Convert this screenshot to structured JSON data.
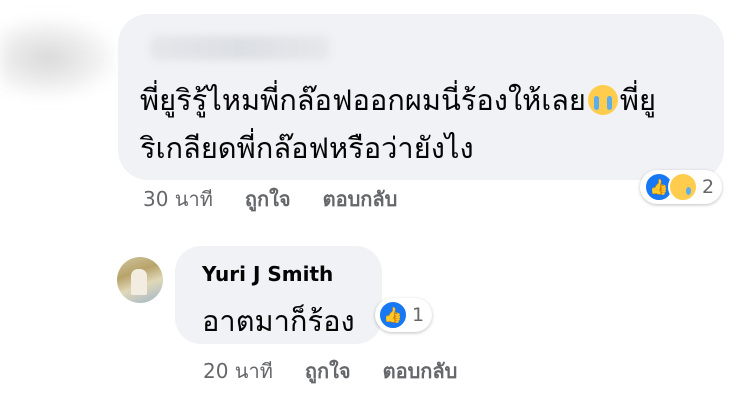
{
  "comment": {
    "text_line1": "พี่ยูริรู้ไหมพี่กล๊อฟออกผมนี่ร้องให้เลย",
    "emoji": "loudly-crying-face",
    "text_line1_tail": "พี่ยู",
    "text_line2": "ริเกลียดพี่กล๊อฟหรือว่ายังไง",
    "reactions": [
      "like",
      "sad"
    ],
    "reaction_count": "2",
    "time": "30 นาที",
    "like_label": "ถูกใจ",
    "reply_label": "ตอบกลับ"
  },
  "reply": {
    "author": "Yuri J Smith",
    "text": "อาตมาก็ร้อง",
    "reactions": [
      "like"
    ],
    "reaction_count": "1",
    "time": "20 นาที",
    "like_label": "ถูกใจ",
    "reply_label": "ตอบกลับ"
  },
  "colors": {
    "bubble": "#f0f2f5",
    "like_blue": "#1877f2",
    "meta_gray": "#65676b"
  }
}
